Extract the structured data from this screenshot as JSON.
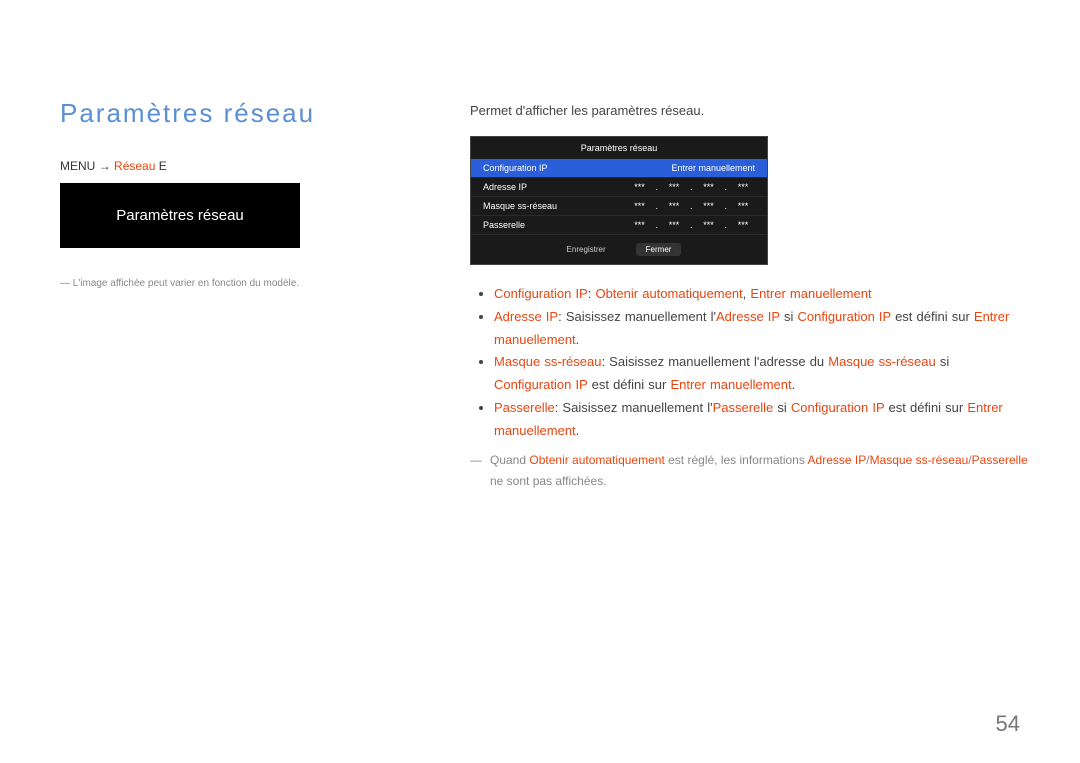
{
  "left": {
    "title": "Paramètres réseau",
    "nav_menu": "MENU",
    "nav_arrow": " → ",
    "nav_red1": "Réseau",
    "nav_enter": " E",
    "box_label": "Paramètres réseau",
    "note": "L'image affichée peut varier en fonction du modèle."
  },
  "lead": "Permet d'afficher les paramètres réseau.",
  "panel": {
    "title": "Paramètres réseau",
    "rows": {
      "ipcfg_label": "Configuration IP",
      "ipcfg_value": "Entrer manuellement",
      "ip_label": "Adresse IP",
      "mask_label": "Masque ss-réseau",
      "gw_label": "Passerelle",
      "octet": "***"
    },
    "save": "Enregistrer",
    "close": "Fermer"
  },
  "bullets": {
    "b1_lbl": "Configuration IP",
    "b1_mid": ": ",
    "b1_red2": "Obtenir automatiquement",
    "b1_sep": ", ",
    "b1_red3": "Entrer manuellement",
    "b2_lbl": "Adresse IP",
    "b2_pre": ": Saisissez manuellement l'",
    "b2_red2": "Adresse IP",
    "b2_mid": " si ",
    "b2_red3": "Configuration IP",
    "b2_post": " est défini sur ",
    "b2_red4": "Entrer manuellement",
    "b2_end": ".",
    "b3_lbl": "Masque ss-réseau",
    "b3_pre": ": Saisissez manuellement l'",
    "b3_mid1": "adresse du ",
    "b3_red2": "Masque ss-réseau",
    "b3_mid2": " si ",
    "b3_red3": "Configuration IP",
    "b3_post": " est défini sur ",
    "b3_red4": "Entrer manuellement",
    "b3_end": ".",
    "b4_lbl": "Passerelle",
    "b4_pre": ": Saisissez manuellement l'",
    "b4_red2": "Passerelle",
    "b4_mid": " si ",
    "b4_red3": "Configuration IP",
    "b4_post": " est défini sur ",
    "b4_red4": "Entrer manuellement",
    "b4_end": "."
  },
  "note": {
    "pre": "Quand ",
    "red1": "Obtenir automatiquement",
    "mid1": " est réglé, les informations ",
    "red2": "Adresse IP",
    "sep": "/",
    "red3": "Masque ss-réseau",
    "sep2": "/",
    "red4": "Passerelle",
    "post": " ne sont pas affichées."
  },
  "page_num": "54"
}
